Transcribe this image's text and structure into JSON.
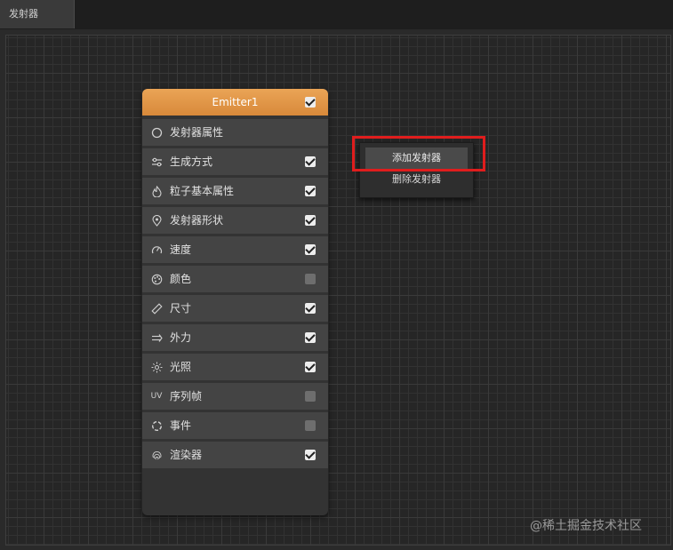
{
  "tab": {
    "label": "发射器"
  },
  "node": {
    "title": "Emitter1",
    "enabled": true,
    "rows": [
      {
        "label": "发射器属性",
        "icon": "circle-icon",
        "checkbox": null
      },
      {
        "label": "生成方式",
        "icon": "sliders-icon",
        "checkbox": true
      },
      {
        "label": "粒子基本属性",
        "icon": "flame-icon",
        "checkbox": true
      },
      {
        "label": "发射器形状",
        "icon": "location-pin-icon",
        "checkbox": true
      },
      {
        "label": "速度",
        "icon": "speedometer-icon",
        "checkbox": true
      },
      {
        "label": "颜色",
        "icon": "palette-icon",
        "checkbox": false
      },
      {
        "label": "尺寸",
        "icon": "ruler-icon",
        "checkbox": true
      },
      {
        "label": "外力",
        "icon": "double-arrow-icon",
        "checkbox": true
      },
      {
        "label": "光照",
        "icon": "sun-icon",
        "checkbox": true
      },
      {
        "label": "序列帧",
        "icon": "uv-icon",
        "icon_text": "UV",
        "checkbox": false
      },
      {
        "label": "事件",
        "icon": "dashed-circle-icon",
        "checkbox": false
      },
      {
        "label": "渲染器",
        "icon": "fingerprint-icon",
        "checkbox": true
      }
    ]
  },
  "context_menu": {
    "items": [
      {
        "label": "添加发射器",
        "highlighted": true
      },
      {
        "label": "删除发射器",
        "highlighted": false
      }
    ]
  },
  "watermark": "@稀土掘金技术社区",
  "colors": {
    "header": "#e09a4b",
    "highlight_box": "#e01d1d"
  }
}
